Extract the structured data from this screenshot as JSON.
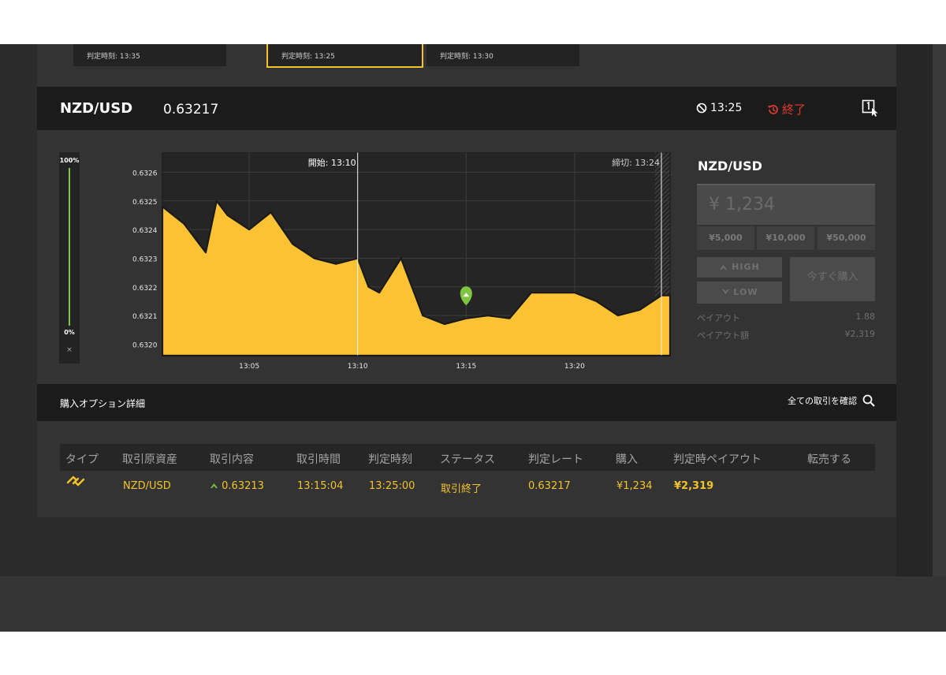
{
  "cards": [
    {
      "label": "判定時刻: 13:35",
      "selected": false
    },
    {
      "label": "判定時刻: 13:25",
      "selected": true
    },
    {
      "label": "判定時刻: 13:30",
      "selected": false
    }
  ],
  "header": {
    "symbol": "NZD/USD",
    "price": "0.63217",
    "timer": "13:25",
    "status": "終了"
  },
  "gauge": {
    "top": "100%",
    "bottom": "0%",
    "close": "×"
  },
  "chart_data": {
    "type": "area",
    "yticks": [
      "0.6326",
      "0.6325",
      "0.6324",
      "0.6323",
      "0.6322",
      "0.6321",
      "0.6320"
    ],
    "xticks": [
      "13:05",
      "13:10",
      "13:15",
      "13:20"
    ],
    "ylim": [
      0.63196,
      0.63267
    ],
    "xlim_minutes": [
      13.0,
      13.41
    ],
    "start_label": "開始: 13:10",
    "end_label": "締切: 13:24",
    "entry": {
      "x": "13:15",
      "y": 0.63213
    },
    "x": [
      "13:01",
      "13:02",
      "13:03",
      "13:03.5",
      "13:04",
      "13:05",
      "13:06",
      "13:07",
      "13:08",
      "13:09",
      "13:10",
      "13:10.5",
      "13:11",
      "13:12",
      "13:13",
      "13:14",
      "13:15",
      "13:16",
      "13:17",
      "13:18",
      "13:19",
      "13:20",
      "13:21",
      "13:22",
      "13:23",
      "13:24"
    ],
    "values": [
      0.63248,
      0.63242,
      0.63232,
      0.6325,
      0.63245,
      0.6324,
      0.63246,
      0.63235,
      0.6323,
      0.63228,
      0.6323,
      0.6322,
      0.63218,
      0.6323,
      0.6321,
      0.63207,
      0.63209,
      0.6321,
      0.63209,
      0.63218,
      0.63218,
      0.63218,
      0.63215,
      0.6321,
      0.63212,
      0.63217
    ],
    "colors": {
      "fill": "#fbc234",
      "edge": "#1a1a1a",
      "grid": "#3d3d3d",
      "marker": "#7ec640"
    }
  },
  "trade": {
    "title": "NZD/USD",
    "amount": "¥ 1,234",
    "presets": [
      "¥5,000",
      "¥10,000",
      "¥50,000"
    ],
    "high": "HIGH",
    "low": "LOW",
    "buy": "今すぐ購入",
    "payout_label": "ペイアウト",
    "payout_value": "1.88",
    "payout_amount_label": "ペイアウト額",
    "payout_amount_value": "¥2,319"
  },
  "options": {
    "title": "購入オプション詳細",
    "link": "全ての取引を確認",
    "columns": [
      "タイプ",
      "取引原資産",
      "取引内容",
      "取引時間",
      "判定時刻",
      "ステータス",
      "判定レート",
      "購入",
      "判定時ペイアウト",
      "転売する"
    ],
    "row": {
      "asset": "NZD/USD",
      "content": "0.63213",
      "time": "13:15:04",
      "judge": "13:25:00",
      "status": "取引終了",
      "rate": "0.63217",
      "buy": "¥1,234",
      "payout": "¥2,319"
    }
  },
  "accent": "#f4c32c"
}
